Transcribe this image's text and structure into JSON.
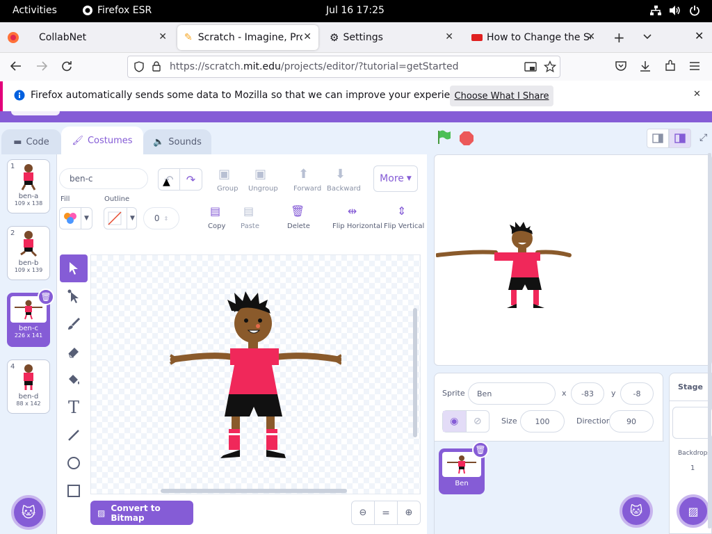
{
  "system_bar": {
    "activities": "Activities",
    "app": "Firefox ESR",
    "clock": "Jul 16  17:25"
  },
  "tabs": [
    {
      "label": "CollabNet"
    },
    {
      "label": "Scratch - Imagine, Prog"
    },
    {
      "label": "Settings"
    },
    {
      "label": "How to Change the Scr"
    }
  ],
  "url": {
    "prefix": "https://scratch.",
    "domain": "mit.edu",
    "path": "/projects/editor/?tutorial=getStarted"
  },
  "notification": {
    "text": "Firefox automatically sends some data to Mozilla so that we can improve your experience.",
    "button": "Choose What I Share"
  },
  "editor_tabs": {
    "code": "Code",
    "costumes": "Costumes",
    "sounds": "Sounds"
  },
  "costumes": [
    {
      "num": "1",
      "name": "ben-a",
      "size": "109 x 138"
    },
    {
      "num": "2",
      "name": "ben-b",
      "size": "109 x 139"
    },
    {
      "num": "3",
      "name": "ben-c",
      "size": "226 x 141"
    },
    {
      "num": "4",
      "name": "ben-d",
      "size": "88 x 142"
    }
  ],
  "paint": {
    "costume_name": "ben-c",
    "group": "Group",
    "ungroup": "Ungroup",
    "forward": "Forward",
    "backward": "Backward",
    "more": "More",
    "fill": "Fill",
    "outline": "Outline",
    "outline_width": "0",
    "copy": "Copy",
    "paste": "Paste",
    "delete": "Delete",
    "flip_h": "Flip Horizontal",
    "flip_v": "Flip Vertical",
    "convert": "Convert to Bitmap"
  },
  "sprite_info": {
    "sprite_label": "Sprite",
    "sprite_name": "Ben",
    "x_label": "x",
    "x": "-83",
    "y_label": "y",
    "y": "-8",
    "size_label": "Size",
    "size": "100",
    "direction_label": "Direction",
    "direction": "90"
  },
  "sprite_list": [
    {
      "name": "Ben"
    }
  ],
  "stage_panel": {
    "title": "Stage",
    "backdrops_label": "Backdrops",
    "backdrops_count": "1"
  },
  "colors": {
    "scratch_purple": "#855cd6",
    "scratch_bg": "#e9f1fc",
    "shirt": "#f0285a"
  }
}
